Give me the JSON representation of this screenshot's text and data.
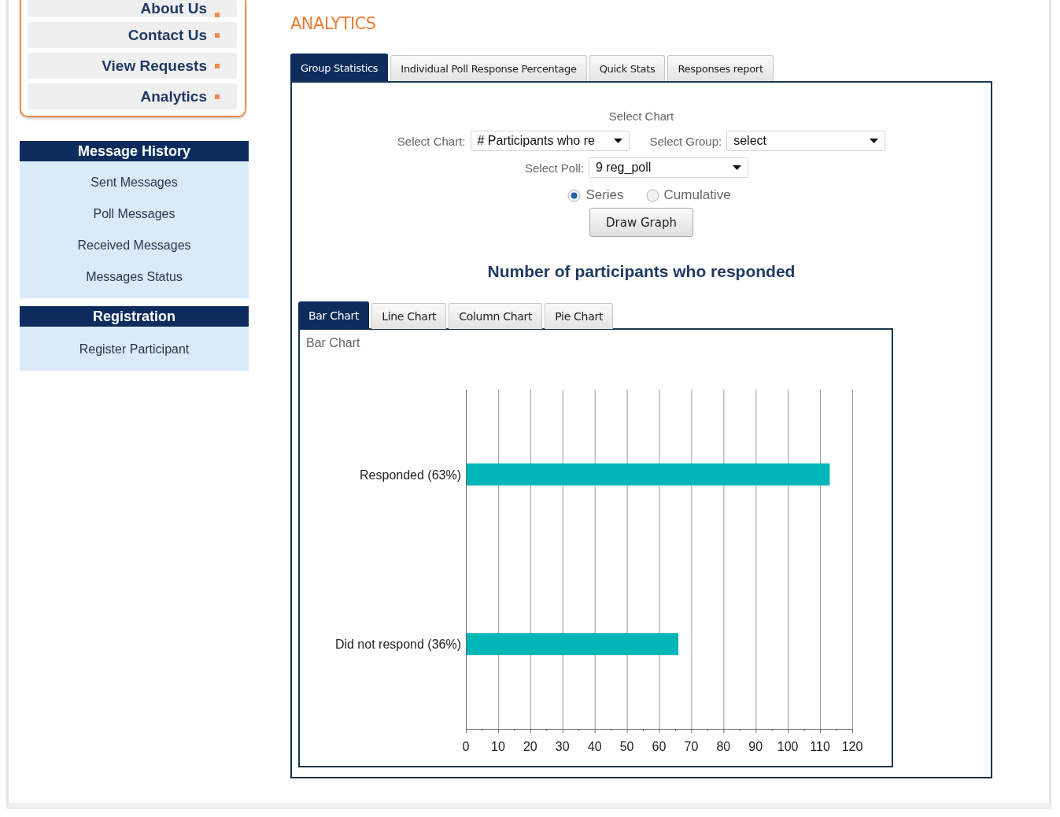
{
  "sidebar": {
    "menu": [
      {
        "label": "About Us"
      },
      {
        "label": "Contact Us"
      },
      {
        "label": "View Requests"
      },
      {
        "label": "Analytics"
      }
    ],
    "sections": [
      {
        "title": "Message History",
        "items": [
          "Sent Messages",
          "Poll Messages",
          "Received Messages",
          "Messages Status"
        ]
      },
      {
        "title": "Registration",
        "items": [
          "Register Participant"
        ]
      }
    ]
  },
  "page_title": "ANALYTICS",
  "tabs": [
    {
      "label": "Group Statistics",
      "selected": true
    },
    {
      "label": "Individual Poll Response Percentage",
      "selected": false
    },
    {
      "label": "Quick Stats",
      "selected": false
    },
    {
      "label": "Responses report",
      "selected": false
    }
  ],
  "form": {
    "heading": "Select Chart",
    "chart_select": {
      "label": "Select Chart:",
      "value": "# Participants who re"
    },
    "group_select": {
      "label": "Select Group:",
      "value": "select"
    },
    "poll_select": {
      "label": "Select Poll:",
      "value": "9 reg_poll"
    },
    "radios": [
      {
        "label": "Series",
        "selected": true
      },
      {
        "label": "Cumulative",
        "selected": false
      }
    ],
    "button": "Draw Graph"
  },
  "chart_heading": "Number of participants who responded",
  "chart_tabs": [
    {
      "label": "Bar Chart",
      "selected": true
    },
    {
      "label": "Line Chart",
      "selected": false
    },
    {
      "label": "Column Chart",
      "selected": false
    },
    {
      "label": "Pie Chart",
      "selected": false
    }
  ],
  "chart_panel": {
    "title": "Bar Chart",
    "chart_data": {
      "type": "bar",
      "orientation": "horizontal",
      "categories": [
        "Responded (63%)",
        "Did not respond (36%)"
      ],
      "series": [
        {
          "color": "#00b5b8",
          "values": [
            113,
            66
          ]
        }
      ],
      "grid": true,
      "xlim": [
        0,
        120
      ],
      "xticks": [
        0,
        10,
        20,
        30,
        40,
        50,
        60,
        70,
        80,
        90,
        100,
        110,
        120
      ]
    }
  }
}
